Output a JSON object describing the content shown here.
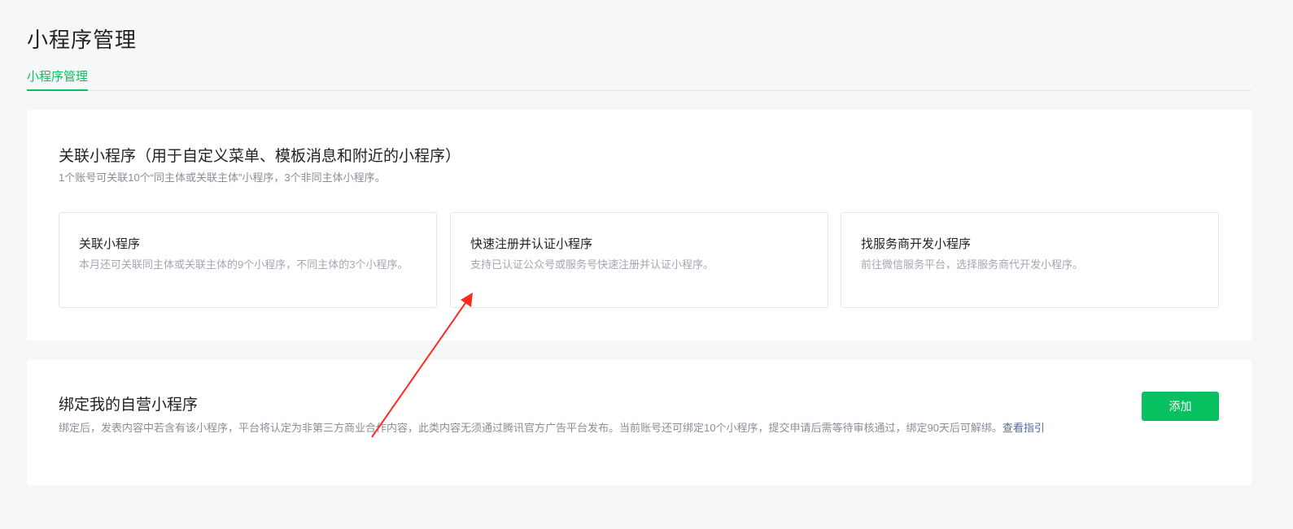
{
  "page_title": "小程序管理",
  "tabs": [
    {
      "label": "小程序管理",
      "active": true
    }
  ],
  "linked_section": {
    "title": "关联小程序（用于自定义菜单、模板消息和附近的小程序）",
    "description": "1个账号可关联10个“同主体或关联主体”小程序，3个非同主体小程序。",
    "options": [
      {
        "title": "关联小程序",
        "description": "本月还可关联同主体或关联主体的9个小程序，不同主体的3个小程序。"
      },
      {
        "title": "快速注册并认证小程序",
        "description": "支持已认证公众号或服务号快速注册并认证小程序。"
      },
      {
        "title": "找服务商开发小程序",
        "description": "前往微信服务平台，选择服务商代开发小程序。"
      }
    ]
  },
  "bind_section": {
    "title": "绑定我的自营小程序",
    "description": "绑定后，发表内容中若含有该小程序，平台将认定为非第三方商业合作内容，此类内容无须通过腾讯官方广告平台发布。当前账号还可绑定10个小程序，提交申请后需等待审核通过，绑定90天后可解绑。",
    "guide_link": "查看指引",
    "add_button": "添加"
  },
  "colors": {
    "accent": "#07c160",
    "link": "#576b95",
    "annotation_arrow": "#ff2a1f"
  }
}
